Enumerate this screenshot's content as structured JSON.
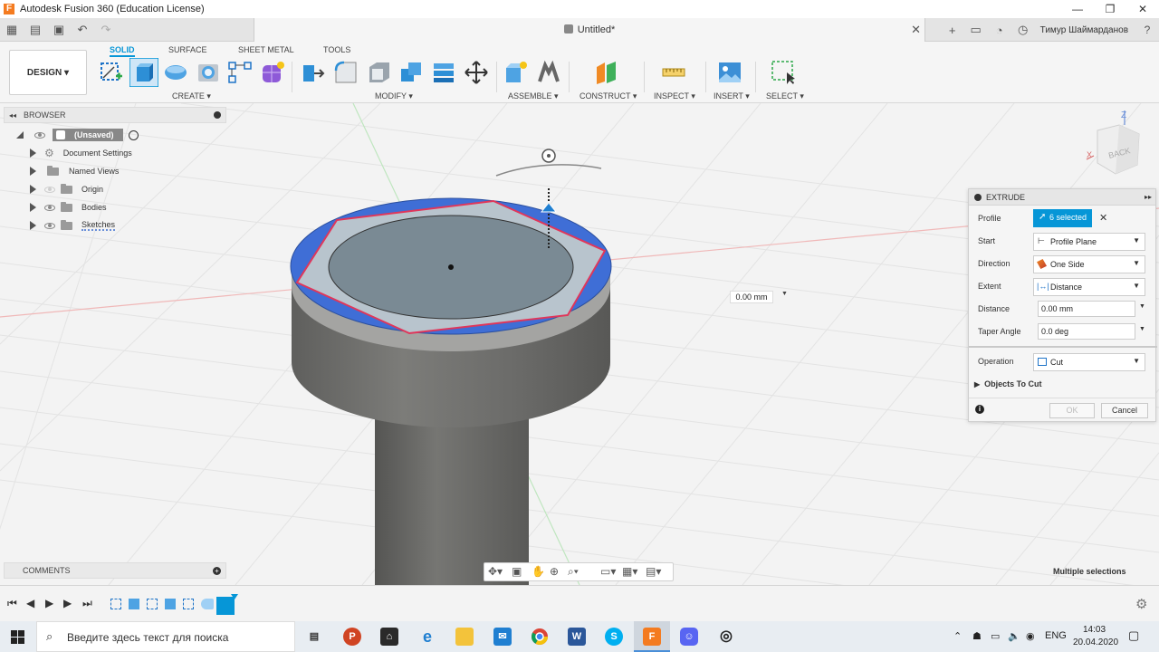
{
  "window": {
    "app_logo": "F",
    "title": "Autodesk Fusion 360 (Education License)",
    "controls": [
      "—",
      "❐",
      "✕"
    ]
  },
  "tabbar": {
    "doc_title": "Untitled*",
    "user": "Тимур Шаймарданов"
  },
  "toolbar": {
    "design_label": "DESIGN",
    "workspace_tabs": [
      "SOLID",
      "SURFACE",
      "SHEET METAL",
      "TOOLS"
    ],
    "groups": [
      "CREATE",
      "MODIFY",
      "ASSEMBLE",
      "CONSTRUCT",
      "INSPECT",
      "INSERT",
      "SELECT"
    ]
  },
  "browser": {
    "header": "BROWSER",
    "root": "(Unsaved)",
    "items": [
      "Document Settings",
      "Named Views",
      "Origin",
      "Bodies",
      "Sketches"
    ]
  },
  "comments": {
    "header": "COMMENTS"
  },
  "viewport": {
    "distance_readout": "0.00 mm",
    "viewcube_face": "BACK",
    "axis_z": "Z",
    "axis_x": "X",
    "status": "Multiple selections"
  },
  "extrude": {
    "title": "EXTRUDE",
    "profile_label": "Profile",
    "profile_value": "6 selected",
    "start_label": "Start",
    "start_value": "Profile Plane",
    "direction_label": "Direction",
    "direction_value": "One Side",
    "extent_label": "Extent",
    "extent_value": "Distance",
    "distance_label": "Distance",
    "distance_value": "0.00 mm",
    "taper_label": "Taper Angle",
    "taper_value": "0.0 deg",
    "operation_label": "Operation",
    "operation_value": "Cut",
    "objects_to_cut": "Objects To Cut",
    "ok": "OK",
    "cancel": "Cancel"
  },
  "taskbar": {
    "search_placeholder": "Введите здесь текст для поиска",
    "lang": "ENG",
    "time": "14:03",
    "date": "20.04.2020",
    "apps": [
      "P",
      "W",
      "S",
      "F"
    ]
  },
  "colors": {
    "accent": "#0696d7",
    "selection_blue": "#3f6ed6",
    "profile_red": "#e0365a",
    "body_gray": "#6e6e6c"
  }
}
